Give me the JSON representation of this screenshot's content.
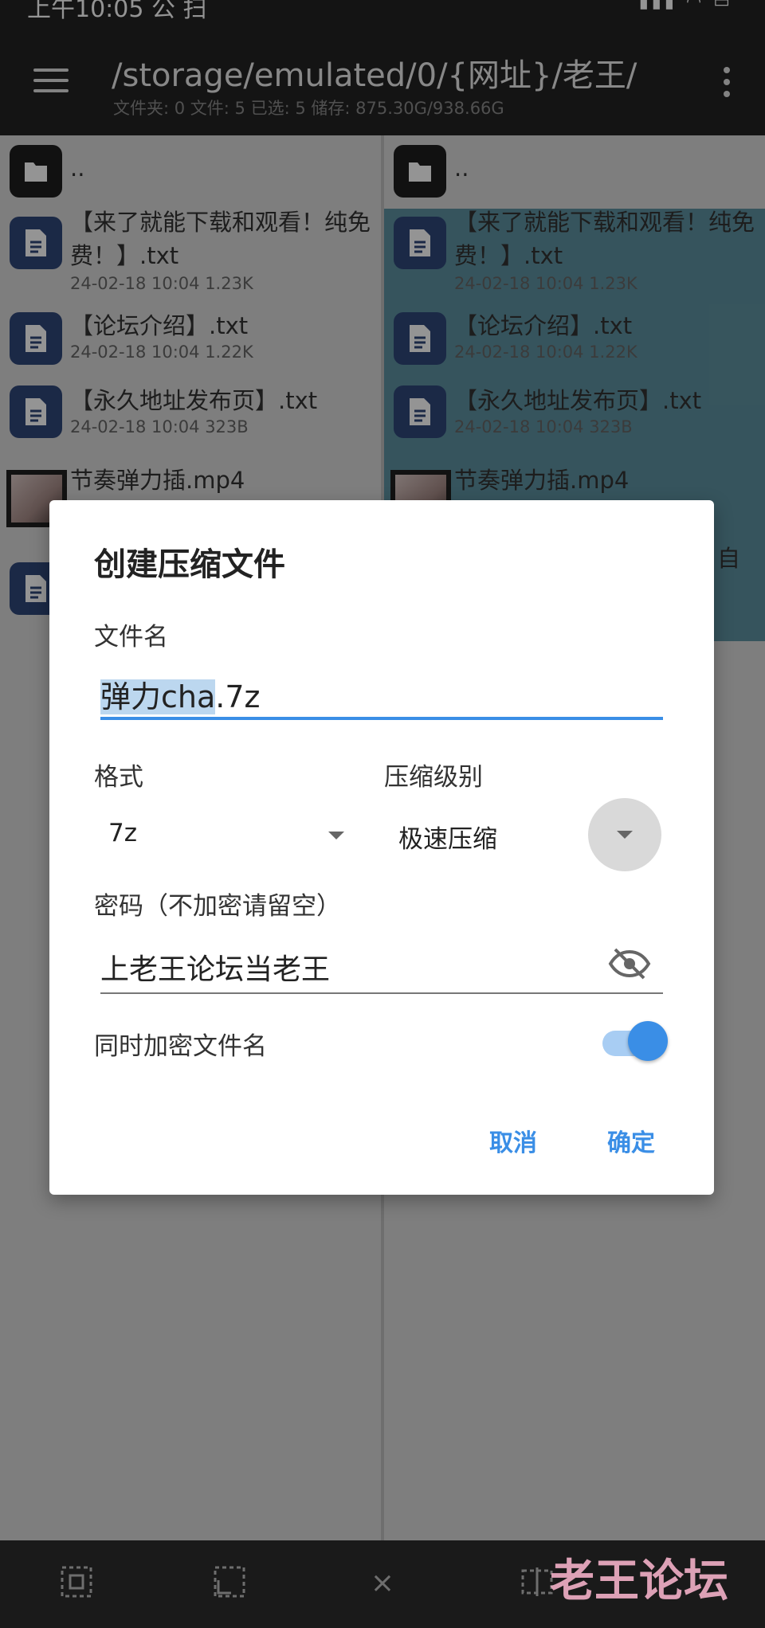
{
  "status_bar": {
    "time": "上午10:05 公 扫",
    "battery": "94"
  },
  "app_bar": {
    "path": "/storage/emulated/0/{网址}/老王/",
    "subtitle": "文件夹: 0  文件: 5  已选: 5  储存: 875.30G/938.66G",
    "menu_icon": "hamburger-menu-icon",
    "more_icon": "more-vert-icon"
  },
  "left_pane": {
    "parent": "..",
    "files": [
      {
        "name": "【来了就能下载和观看！纯免费！】.txt",
        "meta": "24-02-18 10:04  1.23K",
        "type": "txt"
      },
      {
        "name": "【论坛介绍】.txt",
        "meta": "24-02-18 10:04  1.22K",
        "type": "txt"
      },
      {
        "name": "【永久地址发布页】.txt",
        "meta": "24-02-18 10:04  323B",
        "type": "txt"
      },
      {
        "name": "节奏弹力插.mp4",
        "meta": "",
        "type": "video"
      }
    ]
  },
  "right_pane": {
    "parent": "..",
    "files": [
      {
        "name": "【来了就能下载和观看！纯免费！】.txt",
        "meta": "24-02-18 10:04  1.23K",
        "type": "txt"
      },
      {
        "name": "【论坛介绍】.txt",
        "meta": "24-02-18 10:04  1.22K",
        "type": "txt"
      },
      {
        "name": "【永久地址发布页】.txt",
        "meta": "24-02-18 10:04  323B",
        "type": "txt"
      },
      {
        "name": "节奏弹力插.mp4",
        "meta": "",
        "type": "video"
      }
    ],
    "peek_text": "自"
  },
  "dialog": {
    "title": "创建压缩文件",
    "filename_label": "文件名",
    "filename_selected": "弹力cha",
    "filename_ext": ".7z",
    "format_label": "格式",
    "format_value": "7z",
    "level_label": "压缩级别",
    "level_value": "极速压缩",
    "password_label": "密码（不加密请留空）",
    "password_value": "上老王论坛当老王",
    "encrypt_names_label": "同时加密文件名",
    "encrypt_names_on": true,
    "cancel": "取消",
    "ok": "确定",
    "accent_color": "#3a8ee6"
  },
  "toolbar": {
    "icons": [
      "select-all-icon",
      "select-partial-icon",
      "close-icon",
      "invert-selection-icon"
    ],
    "close_glyph": "×"
  },
  "watermark": "老王论坛"
}
